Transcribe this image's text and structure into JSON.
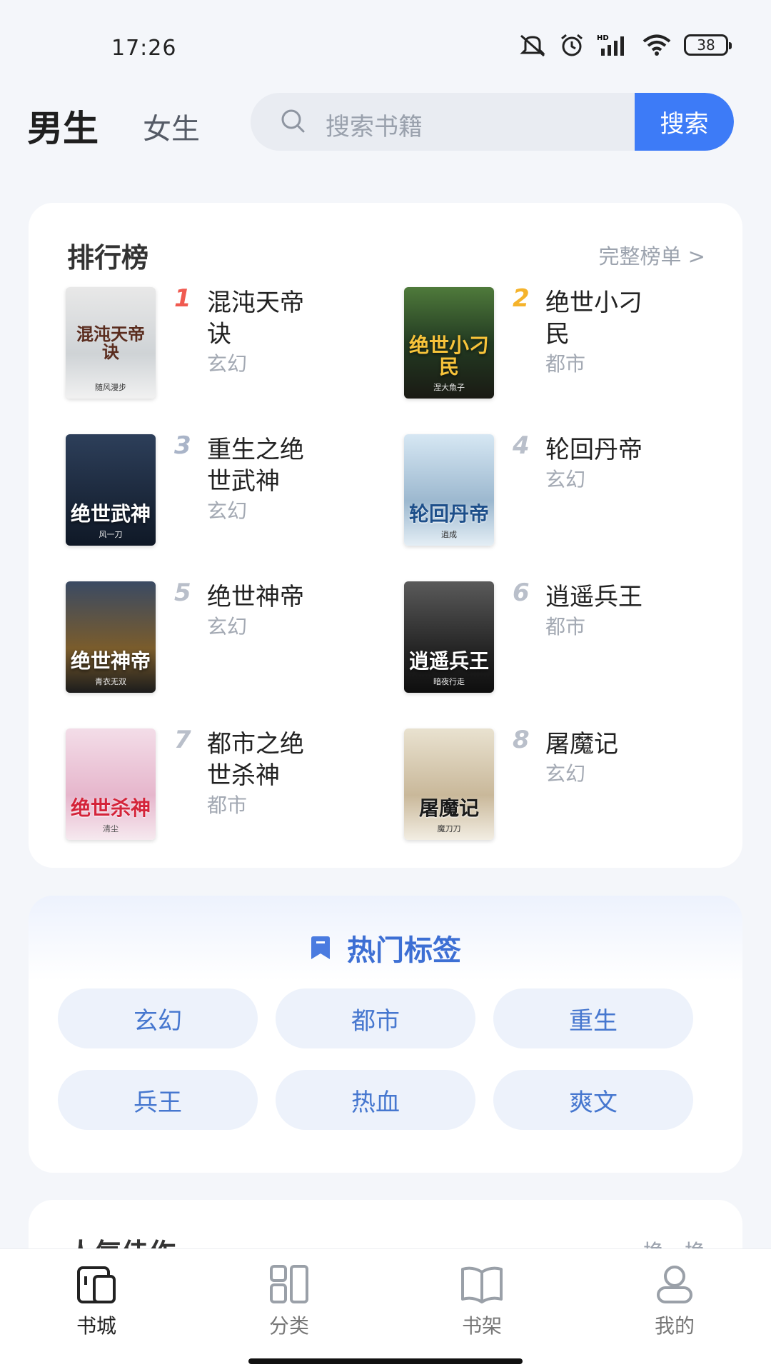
{
  "status_bar": {
    "time": "17:26",
    "battery": "38"
  },
  "header": {
    "tabs": [
      {
        "label": "男生",
        "active": true
      },
      {
        "label": "女生",
        "active": false
      }
    ],
    "search": {
      "placeholder": "搜索书籍",
      "button": "搜索"
    }
  },
  "ranking": {
    "title": "排行榜",
    "more": "完整榜单 >",
    "books": [
      {
        "rank": "1",
        "name": "混沌天帝诀",
        "genre": "玄幻",
        "cover_text": "混沌天帝诀",
        "cover_author": "随风漫步"
      },
      {
        "rank": "2",
        "name": "绝世小刁民",
        "genre": "都市",
        "cover_text": "绝世小刁民",
        "cover_author": "涅大魚子"
      },
      {
        "rank": "3",
        "name": "重生之绝世武神",
        "genre": "玄幻",
        "cover_text": "绝世武神",
        "cover_author": "风一刀"
      },
      {
        "rank": "4",
        "name": "轮回丹帝",
        "genre": "玄幻",
        "cover_text": "轮回丹帝",
        "cover_author": "逍成"
      },
      {
        "rank": "5",
        "name": "绝世神帝",
        "genre": "玄幻",
        "cover_text": "绝世神帝",
        "cover_author": "青衣无双"
      },
      {
        "rank": "6",
        "name": "逍遥兵王",
        "genre": "都市",
        "cover_text": "逍遥兵王",
        "cover_author": "暗夜行走"
      },
      {
        "rank": "7",
        "name": "都市之绝世杀神",
        "genre": "都市",
        "cover_text": "绝世杀神",
        "cover_author": "清尘"
      },
      {
        "rank": "8",
        "name": "屠魔记",
        "genre": "玄幻",
        "cover_text": "屠魔记",
        "cover_author": "魔刀刀"
      }
    ]
  },
  "hot_tags": {
    "title": "热门标签",
    "tags": [
      "玄幻",
      "都市",
      "重生",
      "兵王",
      "热血",
      "爽文"
    ]
  },
  "next_section": {
    "title": "人气佳作",
    "swap": "换一换"
  },
  "bottom_nav": [
    {
      "label": "书城",
      "icon": "bookstore-icon",
      "active": true
    },
    {
      "label": "分类",
      "icon": "category-icon",
      "active": false
    },
    {
      "label": "书架",
      "icon": "bookshelf-icon",
      "active": false
    },
    {
      "label": "我的",
      "icon": "profile-icon",
      "active": false
    }
  ],
  "colors": {
    "accent": "#3d7bf7",
    "tag_text": "#4677cf",
    "rank1": "#f05a50",
    "rank2": "#f5b32b"
  }
}
